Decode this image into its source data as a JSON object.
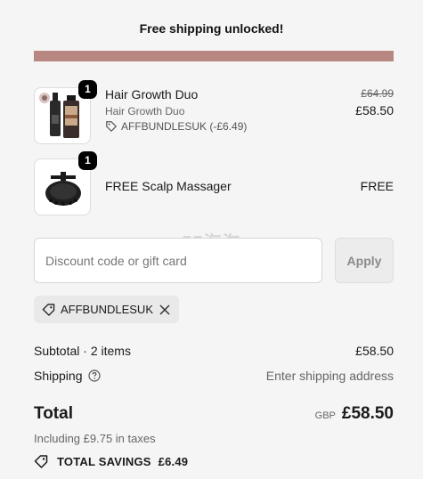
{
  "banner": {
    "text": "Free shipping unlocked!"
  },
  "progress": {
    "fraction": 1.0,
    "color": "#b88782"
  },
  "items": [
    {
      "name": "Hair Growth Duo",
      "variant": "Hair Growth Duo",
      "discount": "AFFBUNDLESUK (-£6.49)",
      "quantity": "1",
      "price_original": "£64.99",
      "price": "£58.50"
    },
    {
      "name": "FREE Scalp Massager",
      "quantity": "1",
      "price": "FREE"
    }
  ],
  "watermark": "55海淘",
  "discount": {
    "placeholder": "Discount code or gift card",
    "apply_label": "Apply",
    "applied_code": "AFFBUNDLESUK"
  },
  "summary": {
    "subtotal_label": "Subtotal · 2 items",
    "subtotal_value": "£58.50",
    "shipping_label": "Shipping",
    "shipping_value": "Enter shipping address",
    "total_label": "Total",
    "currency": "GBP",
    "total_value": "£58.50",
    "taxes_text": "Including £9.75 in taxes",
    "savings_label": "TOTAL SAVINGS",
    "savings_value": "£6.49"
  },
  "colors": {
    "accent": "#b88782",
    "badge": "#000000"
  },
  "icons": [
    "tag-icon",
    "close-icon",
    "question-circle-icon"
  ]
}
